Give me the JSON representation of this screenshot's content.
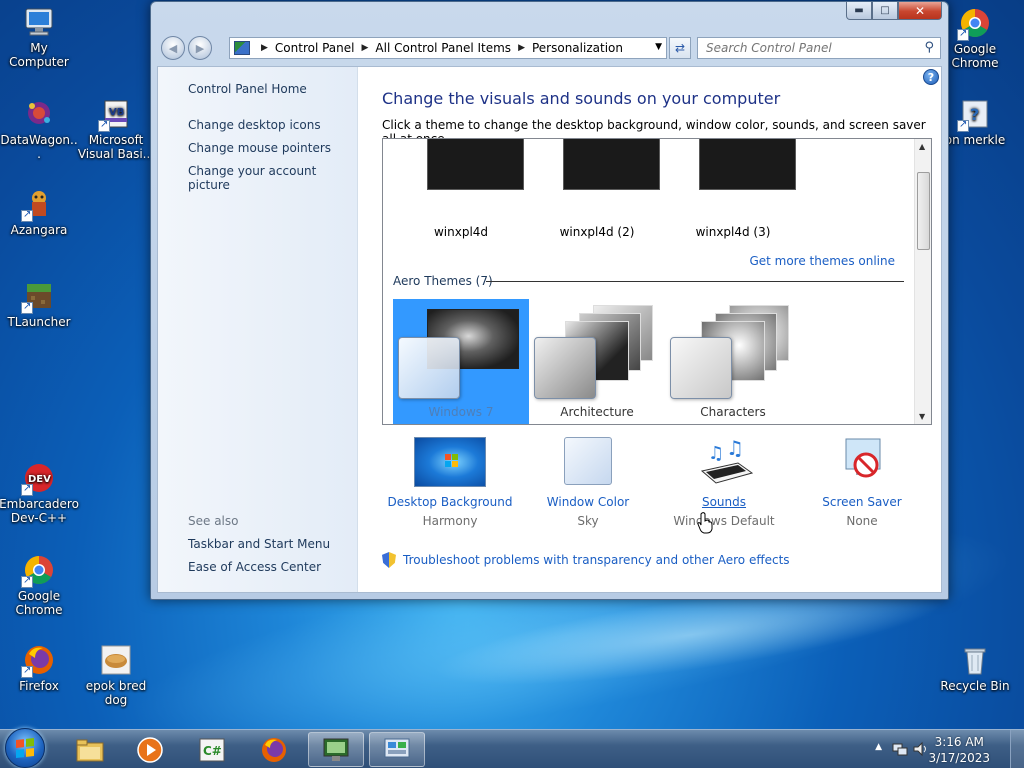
{
  "desktop": {
    "icons_left": [
      {
        "label": "My Computer"
      },
      {
        "label": "DataWagon..."
      },
      {
        "label": "Microsoft Visual Basi..."
      },
      {
        "label": "Azangara"
      },
      {
        "label": "TLauncher"
      },
      {
        "label": "Embarcadero Dev-C++"
      },
      {
        "label": "Google Chrome"
      },
      {
        "label": "Firefox"
      },
      {
        "label": "epok bred dog"
      }
    ],
    "icons_right": [
      {
        "label": "Google Chrome"
      },
      {
        "label": "on merkle"
      },
      {
        "label": "Recycle Bin"
      }
    ]
  },
  "window": {
    "address": {
      "crumbs": [
        "Control Panel",
        "All Control Panel Items",
        "Personalization"
      ]
    },
    "search": {
      "placeholder": "Search Control Panel"
    },
    "left_pane": {
      "home": "Control Panel Home",
      "links": [
        "Change desktop icons",
        "Change mouse pointers",
        "Change your account picture"
      ],
      "see_also_title": "See also",
      "see_also_links": [
        "Taskbar and Start Menu",
        "Ease of Access Center"
      ]
    },
    "main": {
      "title": "Change the visuals and sounds on your computer",
      "description": "Click a theme to change the desktop background, window color, sounds, and screen saver all at once.",
      "my_themes": [
        "winxpl4d",
        "winxpl4d (2)",
        "winxpl4d (3)"
      ],
      "get_more": "Get more themes online",
      "aero_group": "Aero Themes (7)",
      "aero_themes": [
        "Windows 7",
        "Architecture",
        "Characters"
      ],
      "selected_theme": "Windows 7",
      "bottom": [
        {
          "link": "Desktop Background",
          "value": "Harmony"
        },
        {
          "link": "Window Color",
          "value": "Sky"
        },
        {
          "link": "Sounds",
          "value": "Windows Default"
        },
        {
          "link": "Screen Saver",
          "value": "None"
        }
      ],
      "troubleshoot": "Troubleshoot problems with transparency and other Aero effects"
    }
  },
  "taskbar": {
    "time": "3:16 AM",
    "date": "3/17/2023"
  },
  "colors": {
    "link": "#1a5ec4",
    "title": "#1e3287",
    "selection": "#3399ff"
  }
}
